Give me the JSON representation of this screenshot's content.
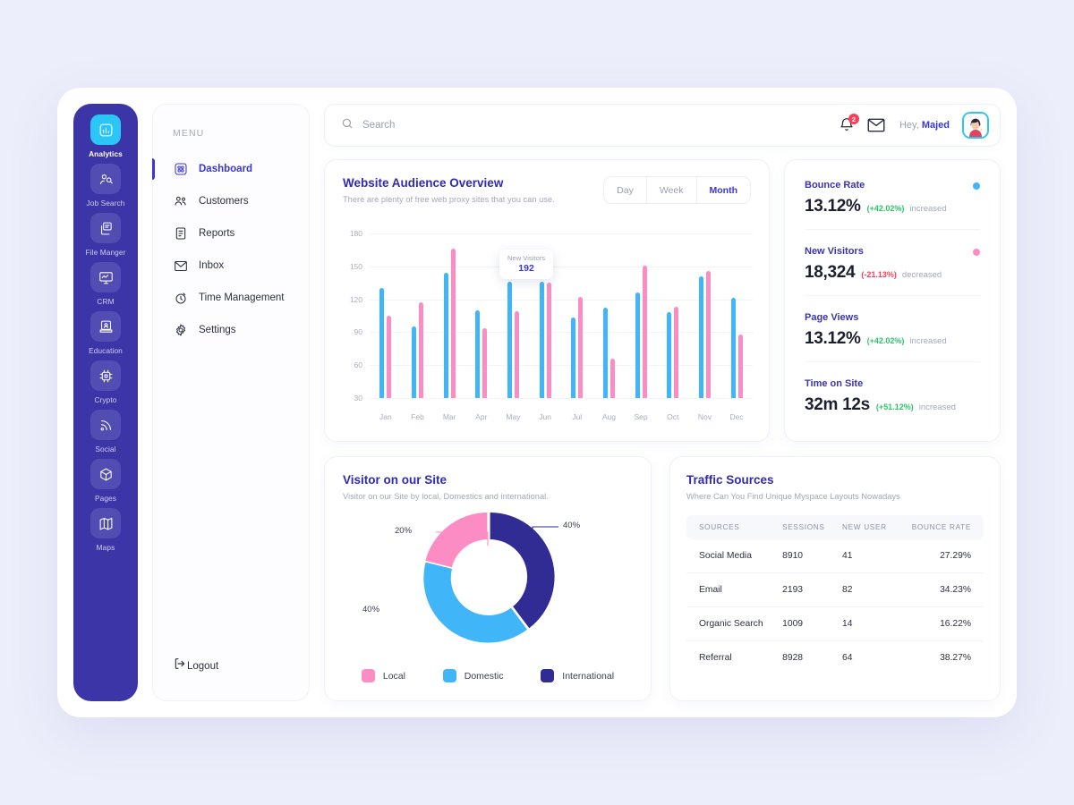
{
  "rail": {
    "items": [
      {
        "label": "Analytics",
        "icon": "bar-chart-icon",
        "active": true
      },
      {
        "label": "Job Search",
        "icon": "job-search-icon",
        "active": false
      },
      {
        "label": "File Manger",
        "icon": "file-manager-icon",
        "active": false
      },
      {
        "label": "CRM",
        "icon": "monitor-icon",
        "active": false
      },
      {
        "label": "Education",
        "icon": "education-icon",
        "active": false
      },
      {
        "label": "Crypto",
        "icon": "chip-icon",
        "active": false
      },
      {
        "label": "Social",
        "icon": "rss-icon",
        "active": false
      },
      {
        "label": "Pages",
        "icon": "cube-icon",
        "active": false
      },
      {
        "label": "Maps",
        "icon": "map-icon",
        "active": false
      }
    ]
  },
  "menu": {
    "title": "MENU",
    "items": [
      {
        "label": "Dashboard",
        "icon": "dashboard-icon",
        "active": true
      },
      {
        "label": "Customers",
        "icon": "users-icon",
        "active": false
      },
      {
        "label": "Reports",
        "icon": "report-icon",
        "active": false
      },
      {
        "label": "Inbox",
        "icon": "envelope-icon",
        "active": false
      },
      {
        "label": "Time Management",
        "icon": "stopwatch-icon",
        "active": false
      },
      {
        "label": "Settings",
        "icon": "gear-icon",
        "active": false
      }
    ],
    "logout": "Logout"
  },
  "header": {
    "search_placeholder": "Search",
    "search_value": "",
    "notification_count": "2",
    "greeting_prefix": "Hey, ",
    "user_name": "Majed"
  },
  "audience": {
    "title": "Website Audience Overview",
    "subtitle": "There are plenty of free web proxy sites that you can use.",
    "range_options": [
      "Day",
      "Week",
      "Month"
    ],
    "range_selected": "Month",
    "tooltip": {
      "label": "New Visitors",
      "value": "192"
    }
  },
  "chart_data": [
    {
      "type": "bar",
      "title": "Website Audience Overview",
      "categories": [
        "Jan",
        "Feb",
        "Mar",
        "Apr",
        "May",
        "Jun",
        "Jul",
        "Aug",
        "Sep",
        "Oct",
        "Nov",
        "Dec"
      ],
      "series": [
        {
          "name": "Visitors",
          "color": "#40b5f8",
          "values": [
            130,
            95,
            144,
            110,
            136,
            136,
            103,
            112,
            126,
            108,
            141,
            121
          ]
        },
        {
          "name": "New Visitors",
          "color": "#fb8dc4",
          "values": [
            105,
            117,
            166,
            94,
            109,
            135,
            122,
            66,
            151,
            113,
            146,
            88
          ]
        }
      ],
      "xlabel": "",
      "ylabel": "",
      "yticks": [
        30,
        60,
        90,
        120,
        150,
        180
      ],
      "ylim": [
        30,
        180
      ],
      "grid": true,
      "legend": "none",
      "annotation": {
        "label": "New Visitors",
        "value": 192,
        "at": "Jun"
      }
    },
    {
      "type": "pie",
      "title": "Visitor on our Site",
      "subtitle": "Visitor on our Site by local, Domestics and international.",
      "labels": [
        "Local",
        "Domestic",
        "International"
      ],
      "values": [
        20,
        40,
        40
      ],
      "display_labels": [
        "20%",
        "40%",
        "40%"
      ],
      "colors": [
        "#fb8dc4",
        "#40b5f8",
        "#312c93"
      ],
      "donut": true,
      "legend": "bottom"
    }
  ],
  "stats": {
    "items": [
      {
        "name": "Bounce Rate",
        "value": "13.12%",
        "delta": "(+42.02%)",
        "direction": "up",
        "word": "increased",
        "dot": "#40b5f8"
      },
      {
        "name": "New Visitors",
        "value": "18,324",
        "delta": "(-21.13%)",
        "direction": "down",
        "word": "decreased",
        "dot": "#fb8dc4"
      },
      {
        "name": "Page Views",
        "value": "13.12%",
        "delta": "(+42.02%)",
        "direction": "up",
        "word": "increased",
        "dot": ""
      },
      {
        "name": "Time on Site",
        "value": "32m 12s",
        "delta": "(+51.12%)",
        "direction": "up",
        "word": "increased",
        "dot": ""
      }
    ]
  },
  "visitor": {
    "title": "Visitor on our Site",
    "subtitle": "Visitor on our Site by local, Domestics and international.",
    "label_local": "20%",
    "label_domestic": "40%",
    "label_international": "40%",
    "legend": [
      {
        "label": "Local",
        "color": "#fb8dc4"
      },
      {
        "label": "Domestic",
        "color": "#40b5f8"
      },
      {
        "label": "International",
        "color": "#312c93"
      }
    ]
  },
  "traffic": {
    "title": "Traffic Sources",
    "subtitle": "Where Can You Find Unique Myspace Layouts Nowadays",
    "columns": [
      "SOURCES",
      "SESSIONS",
      "NEW USER",
      "BOUNCE RATE"
    ],
    "rows": [
      {
        "source": "Social Media",
        "sessions": "8910",
        "new_user": "41",
        "bounce_rate": "27.29%"
      },
      {
        "source": "Email",
        "sessions": "2193",
        "new_user": "82",
        "bounce_rate": "34.23%"
      },
      {
        "source": "Organic Search",
        "sessions": "1009",
        "new_user": "14",
        "bounce_rate": "16.22%"
      },
      {
        "source": "Referral",
        "sessions": "8928",
        "new_user": "64",
        "bounce_rate": "38.27%"
      }
    ]
  }
}
